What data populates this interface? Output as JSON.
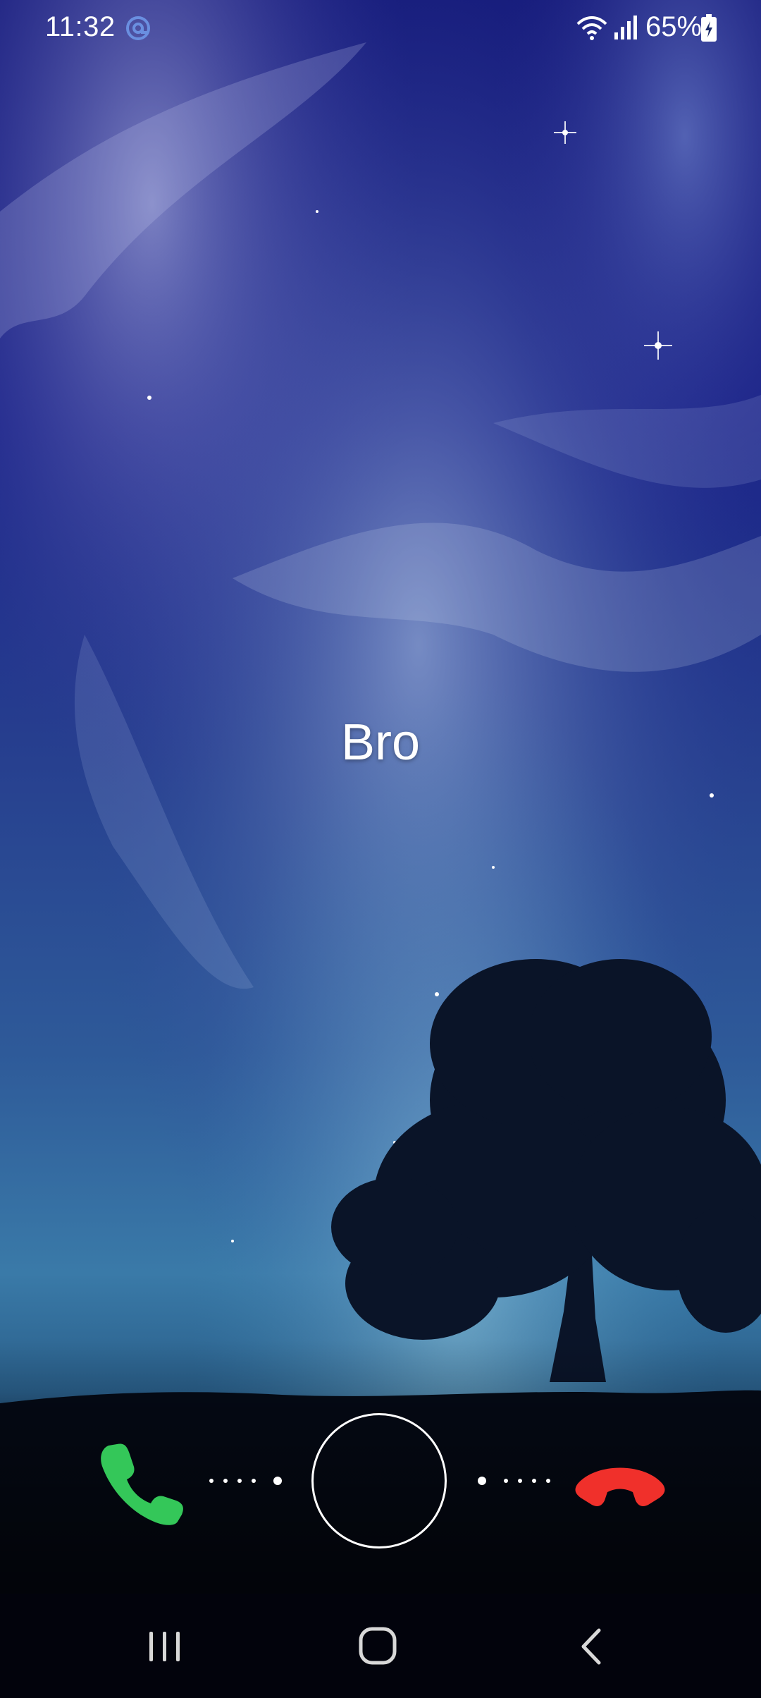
{
  "status_bar": {
    "time": "11:32",
    "battery_percent": "65%",
    "at_icon": "at-sign-notification-icon",
    "wifi_icon": "wifi-icon",
    "signal_icon": "cellular-signal-icon",
    "battery_icon": "battery-charging-icon"
  },
  "call": {
    "caller_name": "Bro",
    "accept_icon": "phone-accept-icon",
    "decline_icon": "phone-decline-icon",
    "accept_color": "#34c759",
    "decline_color": "#f0302b"
  },
  "navigation": {
    "recents_icon": "recent-apps-icon",
    "home_icon": "home-icon",
    "back_icon": "back-chevron-icon"
  }
}
